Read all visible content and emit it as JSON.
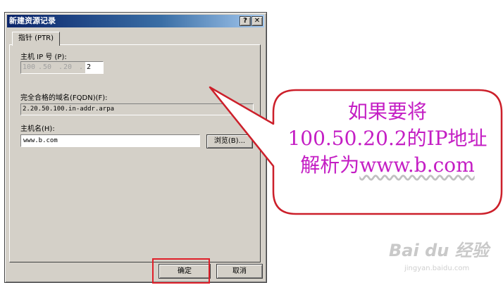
{
  "window": {
    "title": "新建资源记录",
    "help_glyph": "?",
    "close_glyph": "✕"
  },
  "tab": {
    "label": "指针 (PTR)"
  },
  "ip": {
    "label": "主机 IP 号 (P):",
    "octets": [
      "100",
      "50",
      "20",
      "2"
    ]
  },
  "fqdn": {
    "label": "完全合格的域名(FQDN)(F):",
    "value": "2.20.50.100.in-addr.arpa"
  },
  "host": {
    "label": "主机名(H):",
    "value": "www.b.com",
    "browse_label": "浏览(B)..."
  },
  "buttons": {
    "ok": "确定",
    "cancel": "取消"
  },
  "callout": {
    "line1": "如果要将",
    "line2": "100.50.20.2的IP地址",
    "line3_prefix": "解析为",
    "line3_link": "www.b.com"
  },
  "watermark": {
    "brand": "Bai du 经验",
    "sub": "jingyan.baidu.com"
  },
  "colors": {
    "callout_text": "#c41ec4",
    "callout_border": "#cc1f2a",
    "highlight_border": "#e0202a",
    "titlebar_start": "#0a246a"
  }
}
